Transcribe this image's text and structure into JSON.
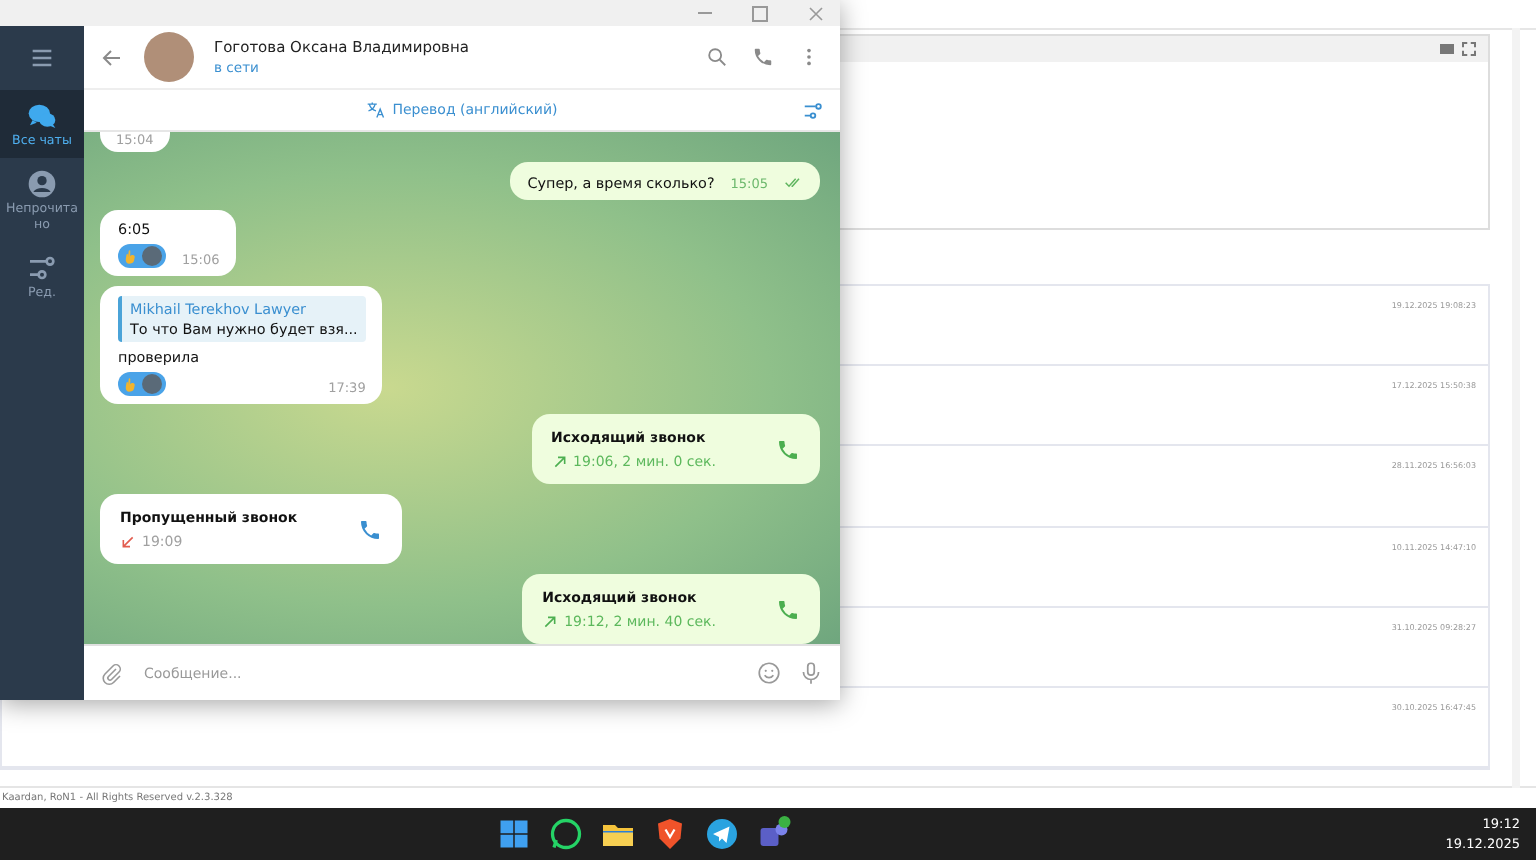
{
  "background_page": {
    "rows": [
      {
        "timestamp": "19.12.2025 19:08:23"
      },
      {
        "timestamp": "17.12.2025 15:50:38"
      },
      {
        "timestamp": "28.11.2025 16:56:03"
      },
      {
        "timestamp": "10.11.2025 14:47:10"
      },
      {
        "timestamp": "31.10.2025 09:28:27"
      },
      {
        "timestamp": "30.10.2025 16:47:45"
      }
    ],
    "footer": "Kaardan, RoN1 - All Rights Reserved v.2.3.328"
  },
  "sidebar": {
    "items": [
      {
        "kind": "chats",
        "label": "Все чаты",
        "selected": true
      },
      {
        "kind": "unread",
        "label": "Непрочитано",
        "selected": false
      },
      {
        "kind": "edit",
        "label": "Ред.",
        "selected": false
      }
    ]
  },
  "chat_header": {
    "name": "Гоготова Оксана Владимировна",
    "status": "в сети"
  },
  "translate_bar": {
    "label": "Перевод (английский)"
  },
  "messages": [
    {
      "kind": "text",
      "outgoing": false,
      "time": "15:04"
    },
    {
      "kind": "text",
      "outgoing": true,
      "text": "Супер, а время сколько?",
      "time": "15:05",
      "read": true
    },
    {
      "kind": "text",
      "outgoing": false,
      "text": "6:05",
      "time": "15:06",
      "reaction": true
    },
    {
      "kind": "text",
      "outgoing": false,
      "reply_author": "Mikhail Terekhov Lawyer",
      "reply_text": "То что Вам нужно будет взя...",
      "text": "проверила",
      "time": "17:39",
      "reaction": true
    },
    {
      "kind": "call",
      "outgoing": true,
      "title": "Исходящий звонок",
      "detail": "19:06, 2 мин. 0 сек.",
      "missed": false
    },
    {
      "kind": "call",
      "outgoing": false,
      "title": "Пропущенный звонок",
      "detail": "19:09",
      "missed": true
    },
    {
      "kind": "call",
      "outgoing": true,
      "title": "Исходящий звонок",
      "detail": "19:12, 2 мин. 40 сек.",
      "missed": false
    }
  ],
  "composer": {
    "placeholder": "Сообщение..."
  },
  "taskbar": {
    "time": "19:12",
    "date": "19.12.2025"
  }
}
